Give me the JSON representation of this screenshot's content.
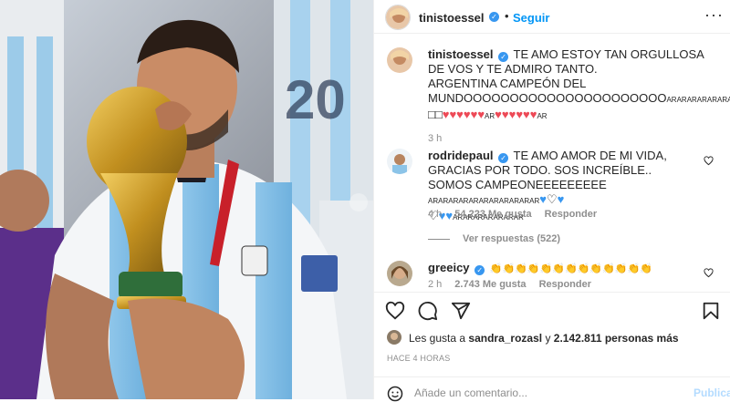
{
  "header": {
    "username": "tinistoessel",
    "dot": "•",
    "follow_label": "Seguir",
    "more_icon": "more-icon"
  },
  "caption": {
    "username": "tinistoessel",
    "line1": "TE AMO ESTOY TAN ORGULLOSA DE VOS Y TE ADMIRO TANTO.",
    "line2": "ARGENTINA CAMPEÓN DEL",
    "line3a": "MUNDOOOOOOOOOOOOOOOOOOOOOO",
    "line3b": "ARARARARARARAR",
    "line3c": "□□□□",
    "line4a": "□□",
    "hearts1": "♥♥♥♥♥♥",
    "ar1": "AR",
    "hearts2": "♥♥♥♥♥♥",
    "ar2": "AR",
    "time": "3 h"
  },
  "comment1": {
    "username": "rodridepaul",
    "line1": "TE AMO AMOR DE MI VIDA, GRACIAS POR TODO. SOS INCREÍBLE..",
    "line2a": "SOMOS CAMPEONEEEEEEEEE",
    "line2b": "ARARARARARARARARARARAR",
    "sym1": "♥",
    "sym2": "♡",
    "sym3": "♥",
    "sym4": "♡",
    "sym5": "♥",
    "sym6": "♥",
    "line3b": "ARARARARARARAR",
    "time": "4 h",
    "likes": "54.223 Me gusta",
    "reply": "Responder",
    "view_replies": "Ver respuestas (522)"
  },
  "comment2": {
    "username": "greeicy",
    "claps": "👏👏👏👏👏👏👏👏👏👏👏👏👏",
    "time": "2 h",
    "likes": "2.743 Me gusta",
    "reply": "Responder"
  },
  "likes": {
    "prefix": "Les gusta a",
    "user": "sandra_rozasl",
    "mid": "y",
    "count": "2.142.811 personas más"
  },
  "timestamp": "HACE 4 HORAS",
  "add_comment": {
    "placeholder": "Añade un comentario...",
    "publish": "Publicar"
  },
  "colors": {
    "accent": "#0095f6",
    "heart": "#ed4956",
    "verified": "#3897f0"
  }
}
